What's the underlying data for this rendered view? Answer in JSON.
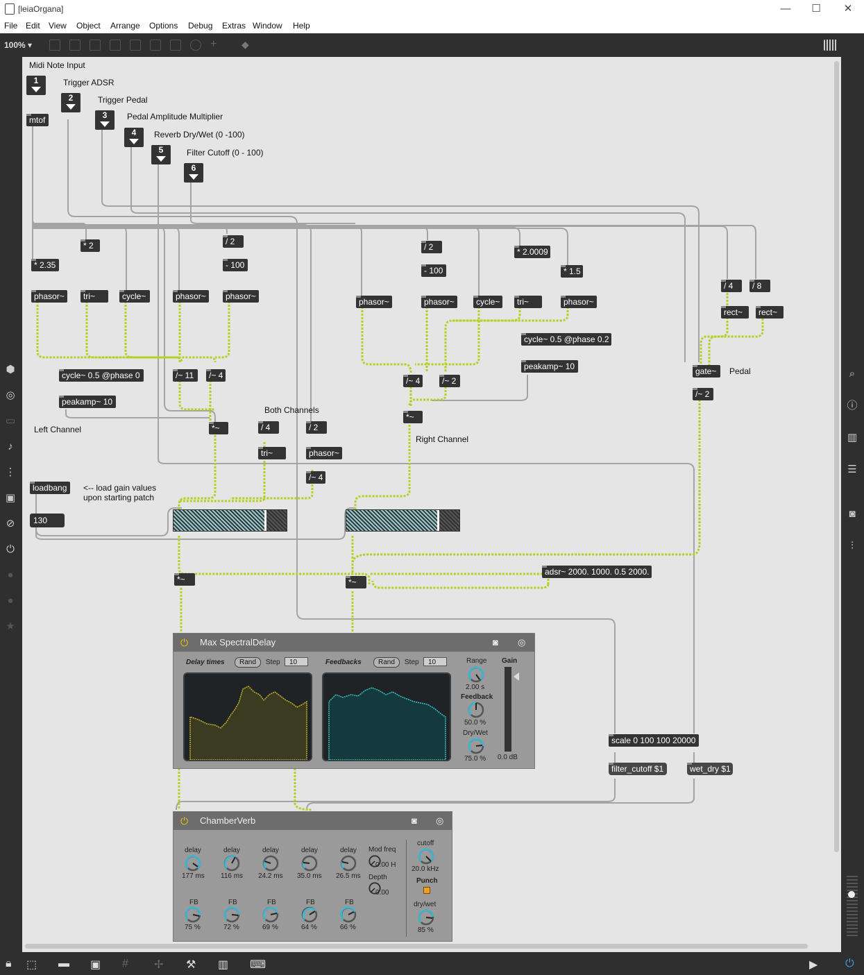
{
  "window": {
    "title": "[leiaOrgana]",
    "minimize_glyph": "—",
    "maximize_glyph": "☐",
    "close_glyph": "✕"
  },
  "menu": [
    "File",
    "Edit",
    "View",
    "Object",
    "Arrange",
    "Options",
    "Debug",
    "Extras",
    "Window",
    "Help"
  ],
  "toolbar": {
    "zoom": "100% ▾"
  },
  "comments": {
    "midi_note_input": "Midi Note Input",
    "trigger_adsr": "Trigger ADSR",
    "trigger_pedal": "Trigger Pedal",
    "pedal_amp": "Pedal Amplitude Multiplier",
    "reverb_drywet": "Reverb Dry/Wet (0 -100)",
    "filter_cutoff": "Filter Cutoff (0 - 100)",
    "left_channel": "Left Channel",
    "both_channels": "Both Channels",
    "right_channel": "Right Channel",
    "pedal": "Pedal",
    "load_gain_1": "<-- load gain values",
    "load_gain_2": "upon starting patch"
  },
  "inlets": [
    "1",
    "2",
    "3",
    "4",
    "5",
    "6"
  ],
  "objects": {
    "mtof": "mtof",
    "mul235": "* 2.35",
    "mul2": "* 2",
    "div2a": "/ 2",
    "sub100a": "- 100",
    "phasor1": "phasor~",
    "tri1": "tri~",
    "cycle1": "cycle~",
    "phasor2": "phasor~",
    "phasor3": "phasor~",
    "cyc05a": "cycle~ 0.5 @phase 0",
    "peakamp1": "peakamp~ 10",
    "sdiv11": "/~ 11",
    "sdiv4a": "/~ 4",
    "smulL": "*~",
    "div4b": "/ 4",
    "tri2": "tri~",
    "div2b": "/ 2",
    "phasor4": "phasor~",
    "sdiv4b": "/~ 4",
    "loadbang": "loadbang",
    "div2c": "/ 2",
    "sub100b": "- 100",
    "mul20009": "* 2.0009",
    "mul15": "* 1.5",
    "phasor5": "phasor~",
    "phasor6": "phasor~",
    "cycle2": "cycle~",
    "tri3": "tri~",
    "phasor7": "phasor~",
    "cyc05b": "cycle~ 0.5 @phase 0.2",
    "peakamp2": "peakamp~ 10",
    "sdiv4c": "/~ 4",
    "sdiv2a": "/~ 2",
    "smulR": "*~",
    "div4c": "/ 4",
    "div8": "/ 8",
    "rect1": "rect~",
    "rect2": "rect~",
    "gate": "gate~",
    "sdiv2b": "/~ 2",
    "adsr": "adsr~ 2000. 1000. 0.5 2000.",
    "smulOutL": "*~",
    "smulOutR": "*~",
    "scale": "scale 0 100 100 20000",
    "filter_msg": "filter_cutoff $1",
    "wetdry_msg": "wet_dry $1"
  },
  "number_box": {
    "value": "130"
  },
  "gains": [
    {
      "level": 0.82
    },
    {
      "level": 0.82
    }
  ],
  "spectral_delay": {
    "title": "Max SpectralDelay",
    "delay_times": "Delay times",
    "feedbacks": "Feedbacks",
    "rand": "Rand",
    "step": "Step",
    "step_value": "10",
    "range_label": "Range",
    "range_value": "2.00 s",
    "feedback_label": "Feedback",
    "feedback_value": "50.0 %",
    "drywet_label": "Dry/Wet",
    "drywet_value": "75.0 %",
    "gain_label": "Gain",
    "gain_value": "0.0 dB",
    "colors": {
      "delay": "#c9b52a",
      "feedback": "#36c4c9"
    }
  },
  "chamber_verb": {
    "title": "ChamberVerb",
    "delay_label": "delay",
    "fb_label": "FB",
    "delays": [
      "177 ms",
      "116 ms",
      "24.2 ms",
      "35.0 ms",
      "26.5 ms"
    ],
    "fbs": [
      "75 %",
      "72 %",
      "69 %",
      "64 %",
      "66 %"
    ],
    "modfreq_label": "Mod freq",
    "modfreq_value": "0.00 H",
    "depth_label": "Depth",
    "depth_value": "0.00",
    "cutoff_label": "cutoff",
    "cutoff_value": "20.0 kHz",
    "punch_label": "Punch",
    "drywet_label": "dry/wet",
    "drywet_value": "85 %"
  },
  "icons": {
    "camera": "camera-icon",
    "power": "power-icon",
    "preset": "preset-icon"
  }
}
